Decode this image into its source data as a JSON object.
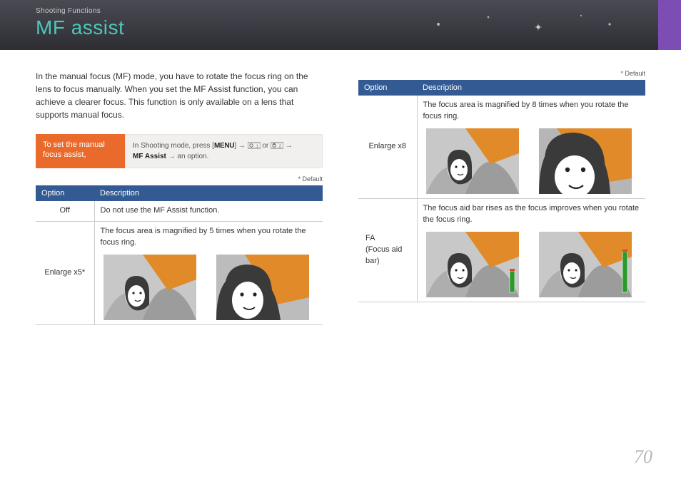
{
  "header": {
    "section": "Shooting Functions",
    "title": "MF assist"
  },
  "intro": "In the manual focus (MF) mode, you have to rotate the focus ring on the lens to focus manually. When you set the MF Assist function, you can achieve a clearer focus. This function is only available on a lens that supports manual focus.",
  "action": {
    "label": "To set the manual focus assist,",
    "prefix": "In Shooting mode, press [",
    "menu": "MENU",
    "sep1": "] → ",
    "or": " or ",
    "sep2": " → ",
    "bold": "MF Assist",
    "suffix": " → an option."
  },
  "default_note": "* Default",
  "table1": {
    "h1": "Option",
    "h2": "Description",
    "rows": {
      "off": {
        "opt": "Off",
        "desc": "Do not use the MF Assist function."
      },
      "x5": {
        "opt": "Enlarge x5*",
        "desc": "The focus area is magnified by 5 times when you rotate the focus ring."
      }
    }
  },
  "table2": {
    "h1": "Option",
    "h2": "Description",
    "rows": {
      "x8": {
        "opt": "Enlarge x8",
        "desc": "The focus area is magnified by 8 times when you rotate the focus ring."
      },
      "fa": {
        "opt_l1": "FA",
        "opt_l2": "(Focus aid bar)",
        "desc": "The focus aid bar rises as the focus improves when you rotate the focus ring."
      }
    }
  },
  "page_number": "70"
}
